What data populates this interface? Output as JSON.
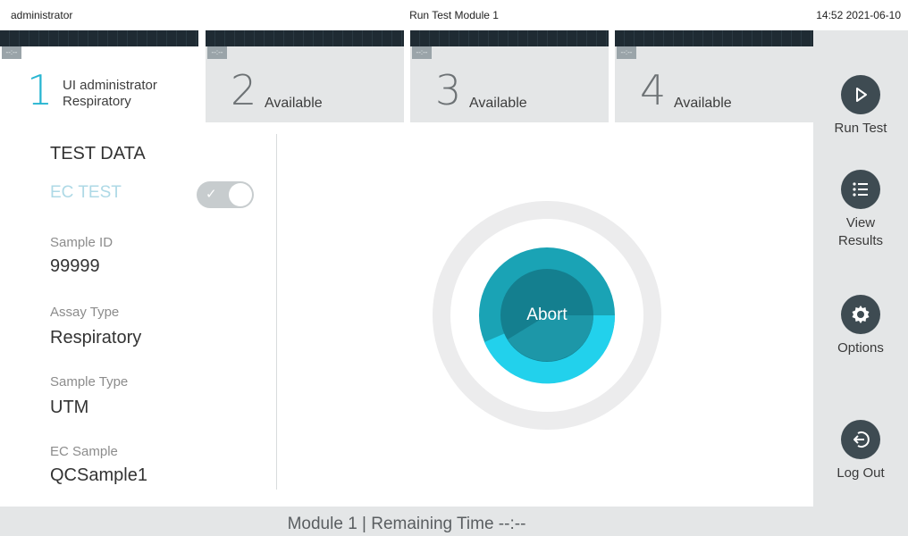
{
  "topbar": {
    "user": "administrator",
    "title": "Run Test Module 1",
    "datetime": "14:52 2021-06-10"
  },
  "tabs": [
    {
      "number": "1",
      "badge": "--:--",
      "label_line1": "UI administrator",
      "label_line2": "Respiratory",
      "active": true
    },
    {
      "number": "2",
      "badge": "--:--",
      "label": "Available",
      "active": false
    },
    {
      "number": "3",
      "badge": "--:--",
      "label": "Available",
      "active": false
    },
    {
      "number": "4",
      "badge": "--:--",
      "label": "Available",
      "active": false
    }
  ],
  "sidebar": {
    "run_test": {
      "label": "Run Test",
      "icon": "play-icon"
    },
    "view_results": {
      "label_line1": "View",
      "label_line2": "Results",
      "icon": "list-icon"
    },
    "options": {
      "label": "Options",
      "icon": "gear-icon"
    },
    "log_out": {
      "label": "Log Out",
      "icon": "logout-icon"
    }
  },
  "test_data": {
    "heading": "TEST DATA",
    "ec_test_label": "EC TEST",
    "ec_test_enabled": true,
    "fields": [
      {
        "label": "Sample ID",
        "value": "99999"
      },
      {
        "label": "Assay Type",
        "value": "Respiratory"
      },
      {
        "label": "Sample Type",
        "value": "UTM"
      },
      {
        "label": "EC Sample",
        "value": "QCSample1"
      }
    ]
  },
  "abort": {
    "label": "Abort",
    "colors": {
      "ring": "#ececed",
      "outer": "#1aa3b5",
      "inner": "#147f8f",
      "progress": "#22d1ec"
    }
  },
  "footer": {
    "text": "Module 1  |  Remaining Time  --:--"
  },
  "colors": {
    "accent": "#27b5d1",
    "sidebar_icon_bg": "#3e4b52",
    "panel_bg": "#e4e6e7"
  }
}
